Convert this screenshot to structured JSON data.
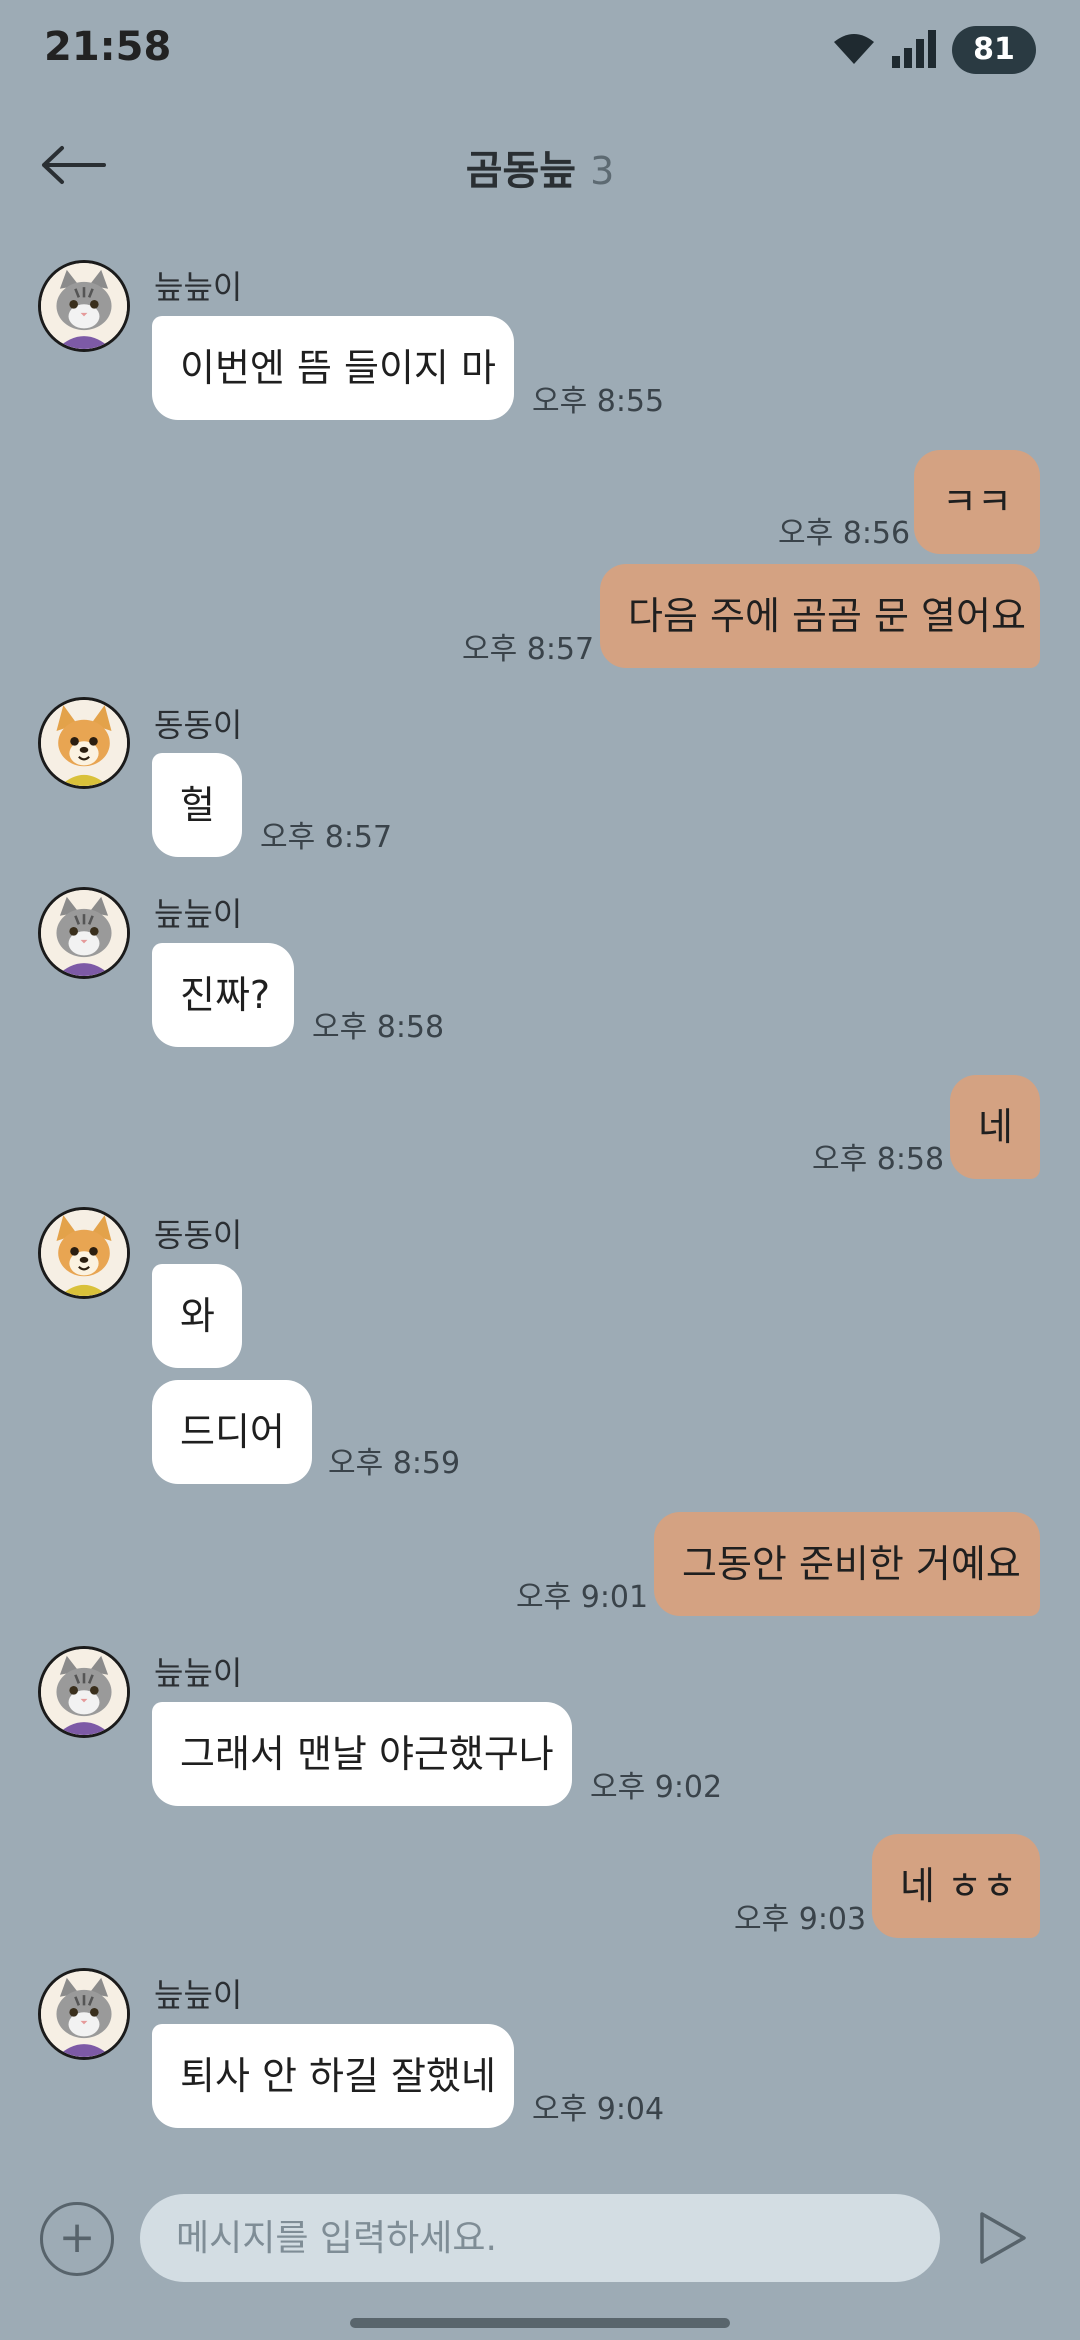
{
  "status": {
    "time": "21:58",
    "battery": "81"
  },
  "header": {
    "title": "곰동늪",
    "member_count": "3"
  },
  "senders": {
    "cat": "늪늪이",
    "dog": "동동이"
  },
  "messages": [
    {
      "text": "이번엔 뜸 들이지 마",
      "time": "오후 8:55"
    },
    {
      "text": "ㅋㅋ",
      "time": "오후 8:56"
    },
    {
      "text": "다음 주에 곰곰 문 열어요",
      "time": "오후 8:57"
    },
    {
      "text": "헐",
      "time": "오후 8:57"
    },
    {
      "text": "진짜?",
      "time": "오후 8:58"
    },
    {
      "text": "네",
      "time": "오후 8:58"
    },
    {
      "text": "와",
      "time": ""
    },
    {
      "text": "드디어",
      "time": "오후 8:59"
    },
    {
      "text": "그동안 준비한 거예요",
      "time": "오후 9:01"
    },
    {
      "text": "그래서 맨날 야근했구나",
      "time": "오후 9:02"
    },
    {
      "text": "네 ㅎㅎ",
      "time": "오후 9:03"
    },
    {
      "text": "퇴사 안 하길 잘했네",
      "time": "오후 9:04"
    }
  ],
  "input": {
    "placeholder": "메시지를 입력하세요."
  },
  "colors": {
    "background": "#9dabb5",
    "incoming": "#ffffff",
    "outgoing": "#d4a282"
  },
  "icons": {
    "back": "arrow-left-icon",
    "plus": "plus-icon",
    "send": "send-icon",
    "wifi": "wifi-icon",
    "signal": "signal-icon"
  }
}
